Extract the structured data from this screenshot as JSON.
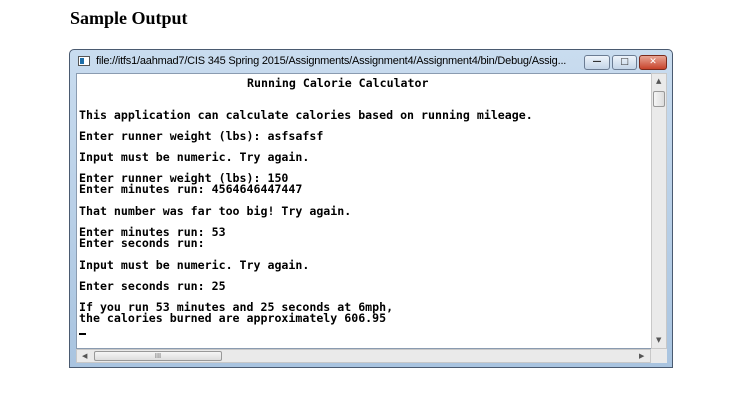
{
  "heading": "Sample Output",
  "window": {
    "title": "file://itfs1/aahmad7/CIS 345 Spring 2015/Assignments/Assignment4/Assignment4/bin/Debug/Assig...",
    "minimize_glyph": "—",
    "maximize_glyph": "□",
    "close_glyph": "✕"
  },
  "console": {
    "header": "Running Calorie Calculator",
    "lines": [
      "This application can calculate calories based on running mileage.",
      "Enter runner weight (lbs): asfsafsf",
      "Input must be numeric. Try again.",
      "Enter runner weight (lbs): 150",
      "Enter minutes run: 4564646447447",
      "That number was far too big! Try again.",
      "Enter minutes run: 53",
      "Enter seconds run:",
      "Input must be numeric. Try again.",
      "Enter seconds run: 25",
      "If you run 53 minutes and 25 seconds at 6mph,",
      "the calories burned are approximately 606.95"
    ]
  },
  "scrollbar": {
    "up": "▲",
    "down": "▼",
    "left": "◀",
    "right": "▶",
    "thumb_grip": "III"
  }
}
